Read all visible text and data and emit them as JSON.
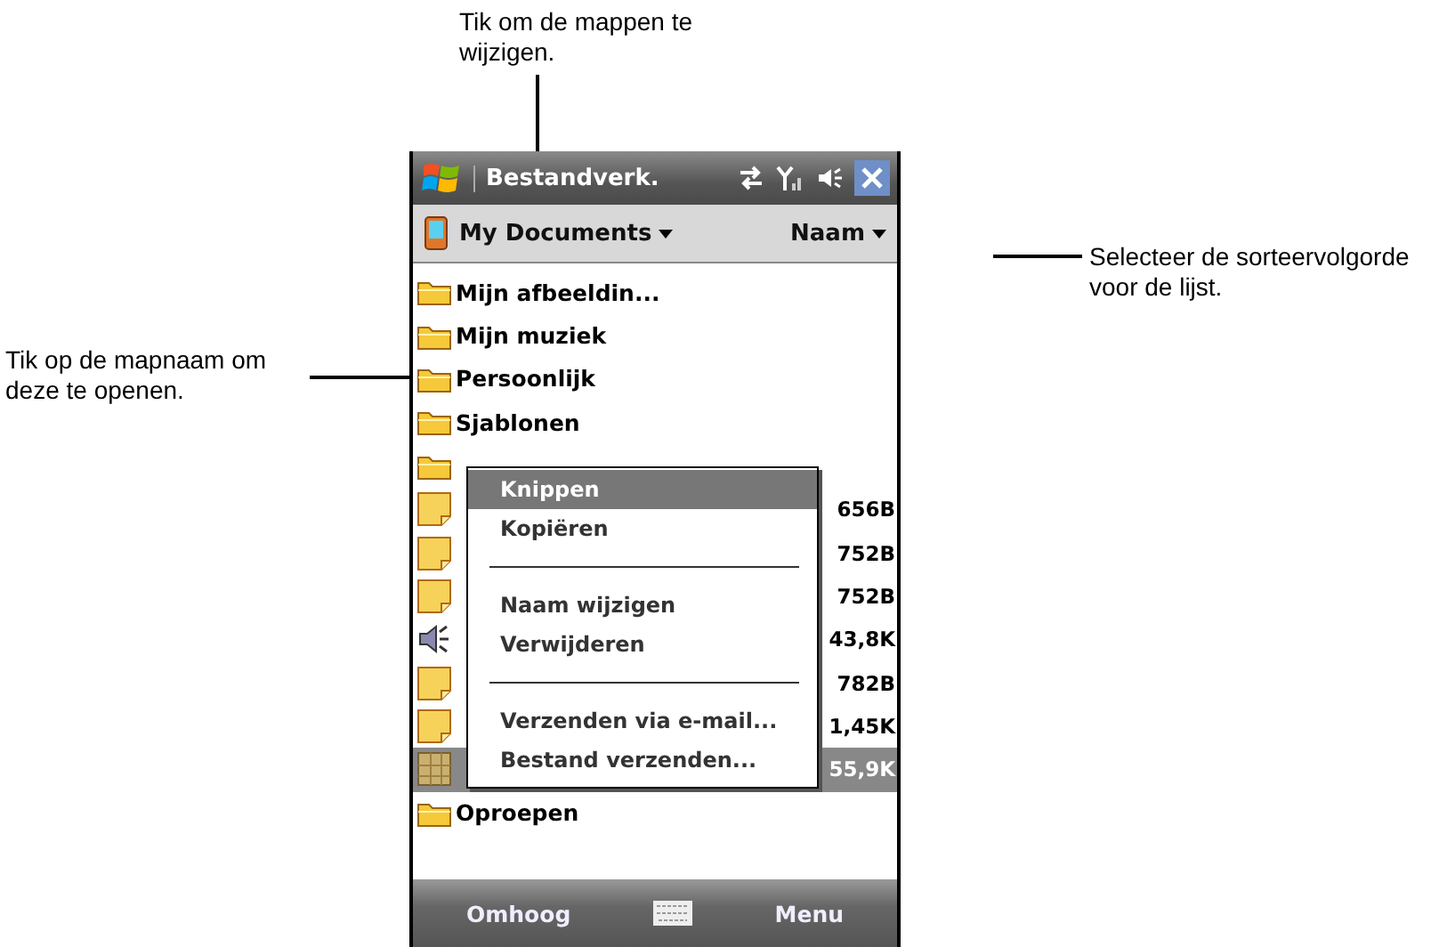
{
  "callouts": [
    {
      "kind": "top",
      "text": "Tik om de mappen te wijzigen."
    },
    {
      "kind": "right",
      "text": "Selecteer de sorteervolgorde voor de lijst."
    },
    {
      "kind": "left",
      "text": "Tik op de mapnaam om deze te openen."
    }
  ],
  "window": {
    "title": "Bestandverk."
  },
  "header": {
    "folder": "My Documents",
    "sort": "Naam"
  },
  "files": [
    {
      "kind": "folder",
      "name": "Mijn afbeeldin...",
      "selected": false
    },
    {
      "kind": "folder",
      "name": "Mijn muziek",
      "selected": false
    },
    {
      "kind": "folder",
      "name": "Persoonlijk",
      "selected": false
    },
    {
      "kind": "folder",
      "name": "Sjablonen",
      "selected": false
    },
    {
      "kind": "folder",
      "selected": false
    },
    {
      "kind": "document",
      "size": "656B",
      "selected": false
    },
    {
      "kind": "document",
      "size": "752B",
      "selected": false
    },
    {
      "kind": "document",
      "size": "752B",
      "selected": false
    },
    {
      "kind": "sound",
      "size": "43,8K",
      "selected": false
    },
    {
      "kind": "document",
      "size": "782B",
      "selected": false
    },
    {
      "kind": "document",
      "size": "1,45K",
      "selected": false
    },
    {
      "kind": "image",
      "size": "55,9K",
      "selected": true
    },
    {
      "kind": "folder",
      "name": "Oproepen",
      "selected": false
    }
  ],
  "context_menu": [
    {
      "kind": "item",
      "label": "Knippen",
      "selected": true
    },
    {
      "kind": "item",
      "label": "Kopiëren",
      "selected": false
    },
    {
      "kind": "separator"
    },
    {
      "kind": "item",
      "label": "Naam wijzigen",
      "selected": false
    },
    {
      "kind": "item",
      "label": "Verwijderen",
      "selected": false
    },
    {
      "kind": "separator"
    },
    {
      "kind": "item",
      "label": "Verzenden via e-mail...",
      "selected": false
    },
    {
      "kind": "item",
      "label": "Bestand verzenden...",
      "selected": false
    }
  ],
  "softkeys": {
    "left": "Omhoog",
    "right": "Menu"
  }
}
